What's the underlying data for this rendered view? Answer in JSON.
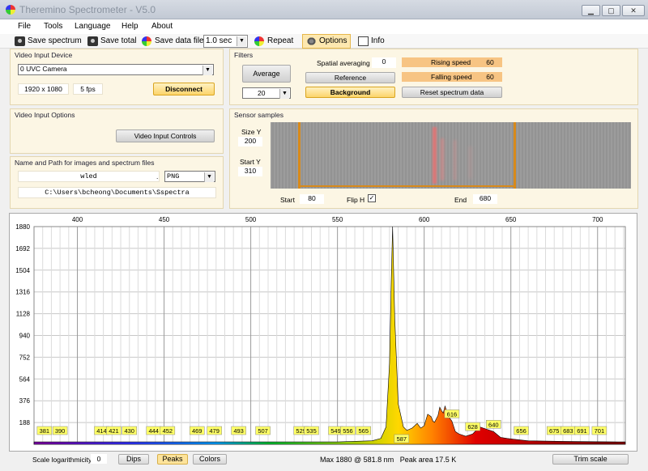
{
  "window": {
    "title": "Theremino Spectrometer - V5.0"
  },
  "menu": [
    "File",
    "Tools",
    "Language",
    "Help",
    "About"
  ],
  "toolbar": {
    "save_spectrum": "Save spectrum",
    "save_total": "Save total",
    "save_data_file": "Save data file",
    "interval": "1.0 sec",
    "repeat": "Repeat",
    "options": "Options",
    "info": "Info"
  },
  "video_input": {
    "title": "Video Input Device",
    "device": "0 UVC Camera",
    "resolution": "1920 x 1080",
    "fps": "5 fps",
    "disconnect": "Disconnect"
  },
  "video_options": {
    "title": "Video Input Options",
    "controls": "Video Input Controls"
  },
  "files": {
    "title": "Name and Path for images and spectrum files",
    "name": "wled",
    "dot": ".",
    "ext": "PNG",
    "path": "C:\\Users\\bcheong\\Documents\\Sspectra"
  },
  "filters": {
    "title": "Filters",
    "average": "Average",
    "average_value": "20",
    "spatial_label": "Spatial averaging",
    "spatial_value": "0",
    "reference": "Reference",
    "background": "Background",
    "rising_label": "Rising speed",
    "rising_value": "60",
    "falling_label": "Falling speed",
    "falling_value": "60",
    "reset": "Reset spectrum data"
  },
  "sensor": {
    "title": "Sensor samples",
    "size_y_label": "Size Y",
    "size_y": "200",
    "start_y_label": "Start Y",
    "start_y": "310",
    "start_label": "Start",
    "start": "80",
    "flip_label": "Flip H",
    "flip_mark": "✓",
    "end_label": "End",
    "end": "680"
  },
  "chart_data": {
    "type": "area",
    "x_ticks": [
      "400",
      "450",
      "500",
      "550",
      "600",
      "650",
      "700"
    ],
    "x_range": [
      375,
      716
    ],
    "y_ticks": [
      "1880",
      "1692",
      "1504",
      "1316",
      "1128",
      "940",
      "752",
      "564",
      "376",
      "188"
    ],
    "y_range": [
      0,
      1880
    ],
    "peak_labels": [
      "381",
      "390",
      "414",
      "421",
      "430",
      "444",
      "452",
      "469",
      "479",
      "493",
      "507",
      "529",
      "535",
      "549",
      "556",
      "565",
      "587",
      "616",
      "628",
      "640",
      "656",
      "675",
      "683",
      "691",
      "701"
    ],
    "series": [
      {
        "x": [
          375,
          450,
          550,
          570,
          575,
          578,
          580,
          581,
          581.8,
          583,
          585,
          588,
          590,
          593,
          596,
          598,
          600,
          602,
          604,
          605,
          606,
          608,
          609,
          610,
          611,
          612,
          614,
          616,
          618,
          620,
          624,
          628,
          632,
          636,
          640,
          644,
          648,
          660,
          680,
          716
        ],
        "y": [
          20,
          20,
          20,
          30,
          50,
          150,
          700,
          1400,
          1880,
          1100,
          350,
          150,
          120,
          140,
          180,
          140,
          160,
          260,
          240,
          200,
          190,
          250,
          320,
          290,
          270,
          330,
          240,
          200,
          110,
          90,
          70,
          90,
          150,
          130,
          110,
          60,
          50,
          30,
          25,
          20
        ]
      }
    ],
    "grid": true
  },
  "status": {
    "scale_log": "Scale logarithmicity",
    "scale_value": "0",
    "dips": "Dips",
    "peaks": "Peaks",
    "colors": "Colors",
    "info": "Max 1880 @ 581.8 nm   Peak area 17.5 K",
    "trim": "Trim scale"
  }
}
